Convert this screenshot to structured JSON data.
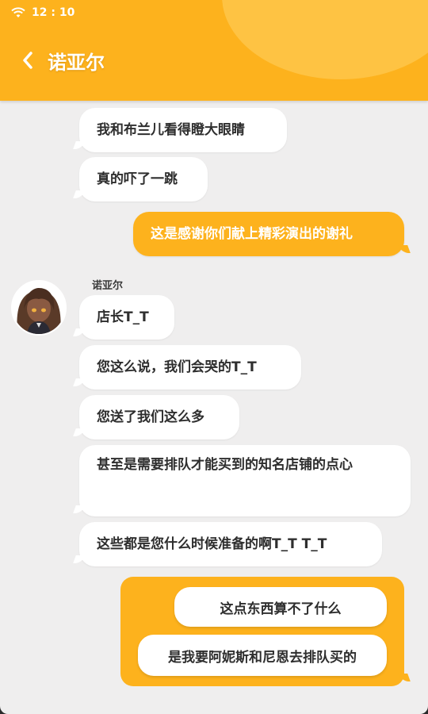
{
  "status_bar": {
    "time": "12 : 10"
  },
  "header": {
    "title": "诺亚尔"
  },
  "sender": {
    "name": "诺亚尔"
  },
  "messages": [
    {
      "text": "我和布兰儿看得瞪大眼睛"
    },
    {
      "text": "真的吓了一跳"
    },
    {
      "text": "这是感谢你们献上精彩演出的谢礼"
    },
    {
      "text": "店长T_T"
    },
    {
      "text": "您这么说，我们会哭的T_T"
    },
    {
      "text": "您送了我们这么多"
    },
    {
      "text": "甚至是需要排队才能买到的知名店铺的点心"
    },
    {
      "text": "这些都是您什么时候准备的啊T_T T_T"
    }
  ],
  "choices": [
    {
      "text": "这点东西算不了什么"
    },
    {
      "text": "是我要阿妮斯和尼恩去排队买的"
    }
  ],
  "colors": {
    "accent": "#fdb21d",
    "background": "#efeeee",
    "bubble": "#ffffff",
    "text": "#2e2e2e"
  }
}
